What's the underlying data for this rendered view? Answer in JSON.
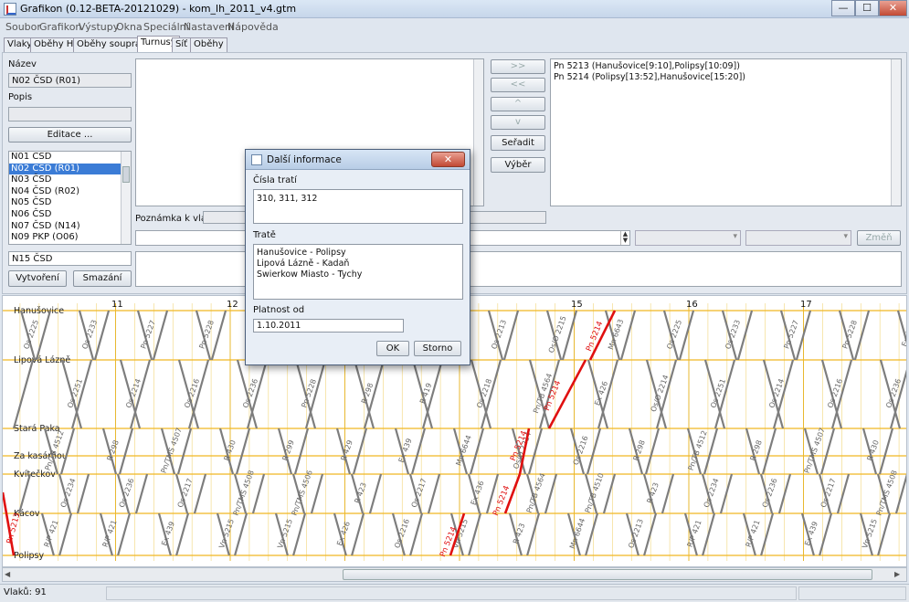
{
  "window": {
    "title": "Grafikon (0.12-BETA-20121029) - kom_lh_2011_v4.gtm",
    "minimize": "—",
    "maximize": "☐",
    "close": "✕"
  },
  "menu": [
    "Soubor",
    "Grafikon",
    "Výstupy",
    "Okna",
    "Speciální",
    "Nastavení",
    "Nápověda"
  ],
  "tabs": [
    "Vlaky",
    "Oběhy HV",
    "Oběhy souprav",
    "Turnusy",
    "Síť",
    "Oběhy"
  ],
  "active_tab": "Turnusy",
  "left_panel": {
    "name_label": "Název",
    "name_value": "N02 ČSD (R01)",
    "desc_label": "Popis",
    "desc_value": "",
    "edit_button": "Editace ...",
    "circuits": [
      "N01 ČSD",
      "N02 ČSD (R01)",
      "N03 ČSD",
      "N04 ČSD (R02)",
      "N05 ČSD",
      "N06 ČSD",
      "N07 ČSD (N14)",
      "N09 PKP (O06)"
    ],
    "selected_index": 1,
    "new_name_value": "N15 ČSD",
    "create_button": "Vytvoření",
    "delete_button": "Smazání"
  },
  "middle_panel": {
    "note_label": "Poznámka k vlaku:",
    "note_value": "",
    "change_button": "Změň"
  },
  "move_buttons": {
    "add": ">>",
    "remove": "<<",
    "up": "^",
    "down": "v",
    "sort": "Seřadit",
    "select": "Výběr"
  },
  "train_list": [
    "Pn 5213 (Hanušovice[9:10],Polipsy[10:09])",
    "Pn 5214 (Polipsy[13:52],Hanušovice[15:20])"
  ],
  "graph": {
    "stations": [
      "Hanušovice",
      "Lipová Lázně",
      "Stará Paka",
      "Za kasárňou",
      "Kvítečkov",
      "Kácov",
      "Polipsy"
    ],
    "hours": [
      "11",
      "12",
      "15",
      "16",
      "17"
    ],
    "trains_gray": [
      "Os 2225",
      "Pn/TB 4512",
      "R/P 421",
      "Os 2251",
      "Os 2234",
      "Os 2233",
      "R 298",
      "R/P 421",
      "Os 2214",
      "Os 2236",
      "Pn 5227",
      "Pn/TMS 4507",
      "Ex 439",
      "Os 2216",
      "Os 2217",
      "Pn 5228",
      "R 430",
      "Vn 5215",
      "Os 2236",
      "Pn/TMS 4508",
      "Ex 436",
      "R 299",
      "Vn 5215",
      "Pn 5228",
      "Pn/TMS 4506",
      "Os 2236",
      "R 429",
      "Ex 426",
      "R 298",
      "R 423",
      "Mn 6643",
      "Ex 439",
      "Os 2216",
      "R 419",
      "Os 2217",
      "R 430",
      "Mn 6644",
      "Vn 5215",
      "Os 2218",
      "Ex 436",
      "Os 2213",
      "Os/O 2214",
      "R 423",
      "Pn/TB 4564",
      "Pn/TB 4564",
      "Os/O 2215",
      "Os 2216",
      "Mn 6644",
      "Ex 426",
      "Pn/TB 4510",
      "Mn 6643",
      "R 298",
      "Os 2213",
      "Os/O 2214",
      "R 423"
    ],
    "trains_red": [
      "Pn 5213",
      "Pn 5214"
    ]
  },
  "status": {
    "trains_count": "Vlaků: 91"
  },
  "dialog": {
    "title": "Další informace",
    "close": "✕",
    "track_numbers_label": "Čísla tratí",
    "track_numbers_value": "310, 311, 312",
    "tracks_label": "Tratě",
    "tracks_lines": [
      "Hanušovice - Polipsy",
      "Lipová Lázně - Kadaň",
      "Swierkow Miasto - Tychy"
    ],
    "valid_from_label": "Platnost od",
    "valid_from_value": "1.10.2011",
    "ok_button": "OK",
    "cancel_button": "Storno"
  }
}
